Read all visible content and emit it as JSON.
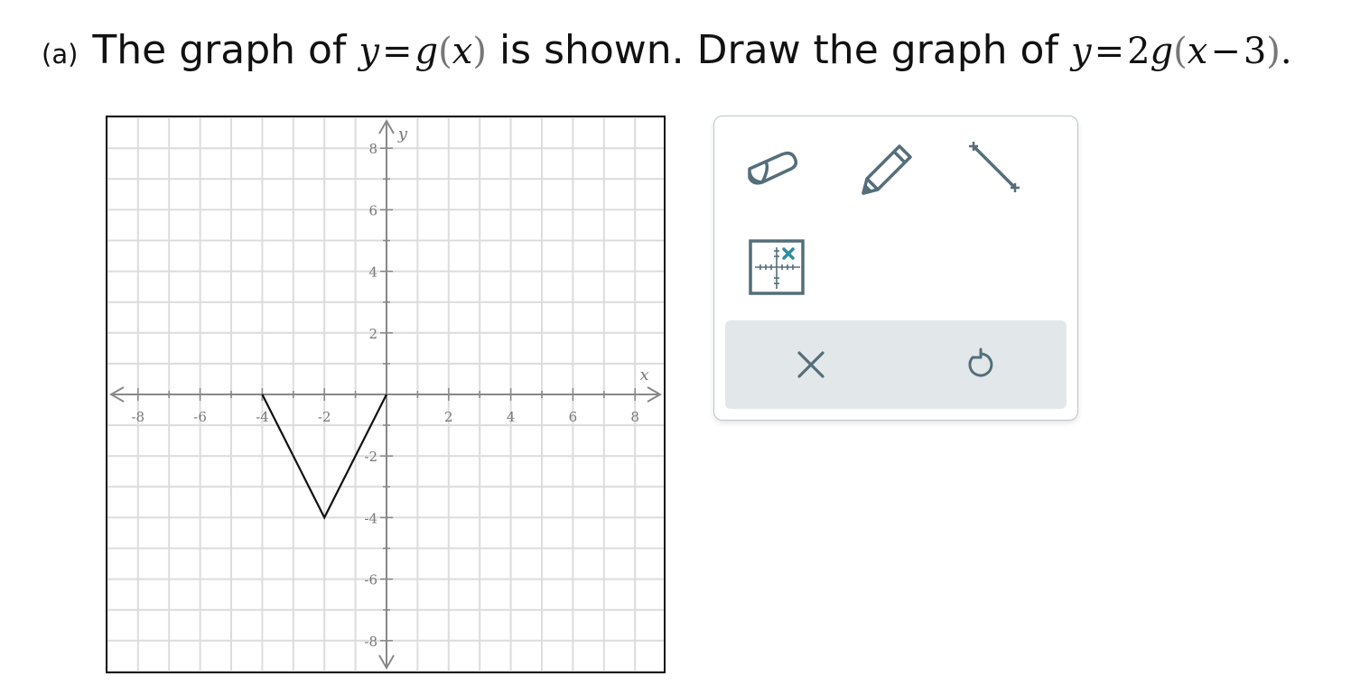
{
  "prompt": {
    "part_label": "(a)",
    "text_before": "The graph of",
    "math_1": {
      "lhs": "y",
      "eq": "=",
      "func": "g",
      "open": "(",
      "arg": "x",
      "close": ")"
    },
    "text_middle": "is shown. Draw the graph of",
    "math_2": {
      "lhs": "y",
      "eq": "=",
      "coef": "2",
      "func": "g",
      "open": "(",
      "arg": "x",
      "minus": "−",
      "shift": "3",
      "close": ")"
    },
    "text_end": "."
  },
  "graph": {
    "x_axis_label": "x",
    "y_axis_label": "y",
    "x_range": [
      -9,
      9
    ],
    "y_range": [
      -9,
      9
    ],
    "x_tick_labels": [
      {
        "value": -8,
        "text": "-8"
      },
      {
        "value": -6,
        "text": "-6"
      },
      {
        "value": -4,
        "text": "-4"
      },
      {
        "value": -2,
        "text": "-2"
      },
      {
        "value": 2,
        "text": "2"
      },
      {
        "value": 4,
        "text": "4"
      },
      {
        "value": 6,
        "text": "6"
      },
      {
        "value": 8,
        "text": "8"
      }
    ],
    "y_tick_labels": [
      {
        "value": 8,
        "text": "8"
      },
      {
        "value": 6,
        "text": "6"
      },
      {
        "value": 4,
        "text": "4"
      },
      {
        "value": 2,
        "text": "2"
      },
      {
        "value": -2,
        "text": "-2"
      },
      {
        "value": -4,
        "text": "-4"
      },
      {
        "value": -6,
        "text": "-6"
      },
      {
        "value": -8,
        "text": "-8"
      }
    ],
    "function_g_points": [
      [
        -4,
        0
      ],
      [
        -2,
        -4
      ],
      [
        0,
        0
      ]
    ],
    "grid": true,
    "colors": {
      "grid": "#dcdcdc",
      "axis": "#888888",
      "curve": "#111111",
      "tick_text": "#777777"
    }
  },
  "tools": {
    "eraser": "eraser-icon",
    "pencil": "pencil-icon",
    "line": "line-segment-icon",
    "point": "graph-point-icon",
    "clear": "close-icon",
    "undo": "undo-icon",
    "colors": {
      "icon": "#546e7a",
      "accent": "#2e8fa0",
      "panel_border": "#b9c7cc",
      "action_bar": "#e2e8ea"
    }
  }
}
